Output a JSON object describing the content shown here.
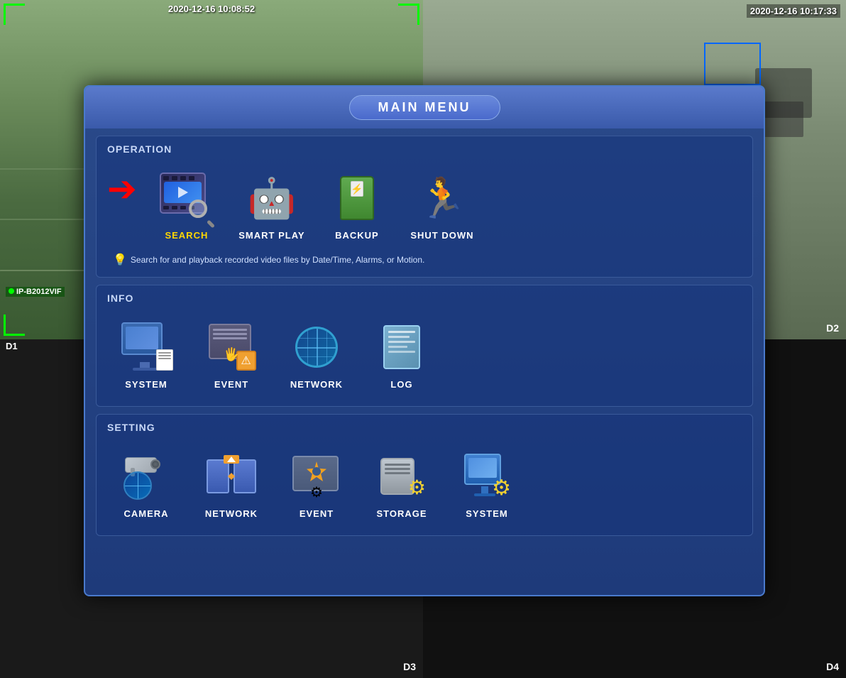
{
  "cameras": {
    "top_left": {
      "timestamp": "2020-12-16 10:08:52",
      "label": "D1",
      "ip_label": "IP-B2012VIF"
    },
    "top_right": {
      "timestamp": "2020-12-16 10:17:33",
      "label": "D2"
    },
    "bottom_left": {
      "label": "D3"
    },
    "bottom_right": {
      "label": "D4"
    }
  },
  "main_menu": {
    "title": "MAIN MENU",
    "sections": {
      "operation": {
        "title": "OPERATION",
        "items": [
          {
            "id": "search",
            "label": "SEARCH",
            "selected": true
          },
          {
            "id": "smart-play",
            "label": "SMART PLAY",
            "selected": false
          },
          {
            "id": "backup",
            "label": "BACKUP",
            "selected": false
          },
          {
            "id": "shutdown",
            "label": "SHUT DOWN",
            "selected": false
          }
        ],
        "hint": "Search for and playback recorded video files by Date/Time, Alarms, or Motion."
      },
      "info": {
        "title": "INFO",
        "items": [
          {
            "id": "system",
            "label": "SYSTEM",
            "selected": false
          },
          {
            "id": "event",
            "label": "EVENT",
            "selected": false
          },
          {
            "id": "network",
            "label": "NETWORK",
            "selected": false
          },
          {
            "id": "log",
            "label": "LOG",
            "selected": false
          }
        ]
      },
      "setting": {
        "title": "SETTING",
        "items": [
          {
            "id": "camera",
            "label": "CAMERA",
            "selected": false
          },
          {
            "id": "network",
            "label": "NETWORK",
            "selected": false
          },
          {
            "id": "event",
            "label": "EVENT",
            "selected": false
          },
          {
            "id": "storage",
            "label": "STORAGE",
            "selected": false
          },
          {
            "id": "system",
            "label": "SYSTEM",
            "selected": false
          }
        ]
      }
    }
  }
}
